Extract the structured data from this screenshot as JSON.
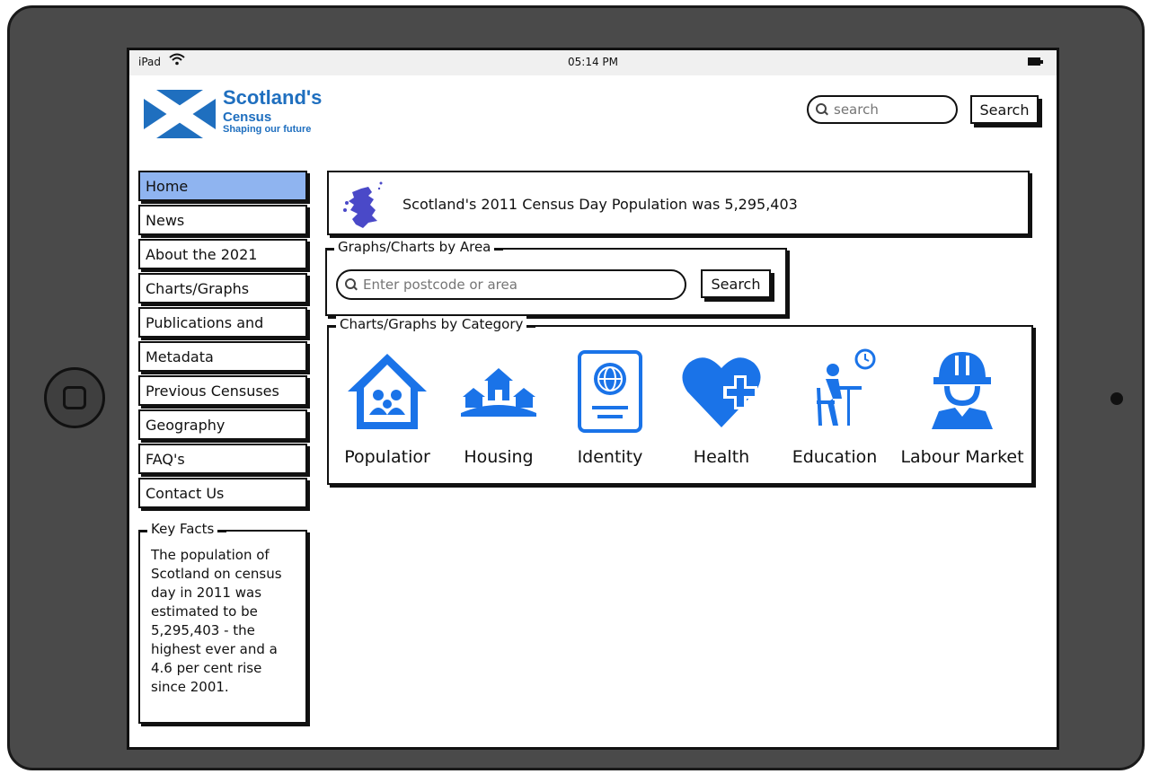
{
  "statusbar": {
    "carrier": "iPad",
    "time": "05:14 PM",
    "icons": [
      "wifi-icon",
      "battery-icon"
    ]
  },
  "logo": {
    "line1": "Scotland's",
    "line2": "Census",
    "line3": "Shaping our future"
  },
  "header_search": {
    "placeholder": "search",
    "button_label": "Search"
  },
  "nav": {
    "items": [
      {
        "label": "Home",
        "active": true
      },
      {
        "label": "News"
      },
      {
        "label": "About the 2021"
      },
      {
        "label": "Charts/Graphs"
      },
      {
        "label": "Publications and"
      },
      {
        "label": "Metadata"
      },
      {
        "label": "Previous Censuses"
      },
      {
        "label": "Geography"
      },
      {
        "label": "FAQ's"
      },
      {
        "label": "Contact Us"
      }
    ]
  },
  "key_facts": {
    "title": "Key Facts",
    "text": "The population of Scotland on census day in 2011 was estimated to be 5,295,403 - the highest ever and a 4.6 per cent rise since 2001."
  },
  "banner": {
    "text": "Scotland's 2011 Census Day Population was 5,295,403"
  },
  "area_search": {
    "title": "Graphs/Charts by Area",
    "placeholder": "Enter postcode or area",
    "button_label": "Search"
  },
  "categories": {
    "title": "Charts/Graphs by Category",
    "items": [
      {
        "label": "Populatior",
        "icon": "population-house-icon"
      },
      {
        "label": "Housing",
        "icon": "housing-icon"
      },
      {
        "label": "Identity",
        "icon": "passport-icon"
      },
      {
        "label": "Health",
        "icon": "health-heart-icon"
      },
      {
        "label": "Education",
        "icon": "education-icon"
      },
      {
        "label": "Labour Market",
        "icon": "worker-helmet-icon"
      }
    ]
  },
  "colors": {
    "accent": "#1a73e8",
    "nav_active": "#8fb4f0",
    "logo_blue": "#1f6fbf",
    "device": "#4a4a4a"
  }
}
